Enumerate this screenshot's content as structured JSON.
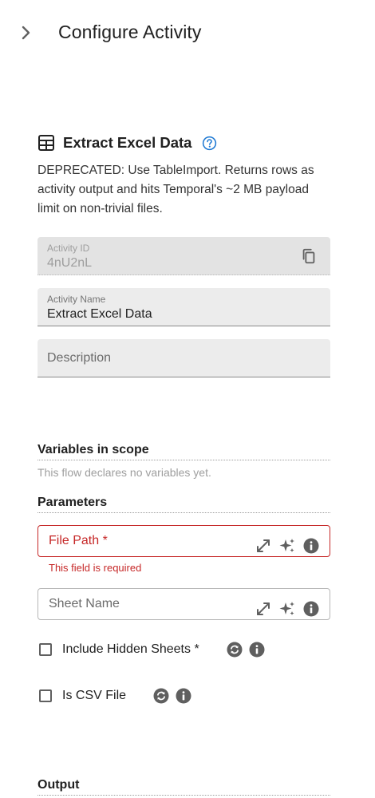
{
  "header": {
    "title": "Configure Activity"
  },
  "activity": {
    "title": "Extract Excel Data",
    "description": "DEPRECATED: Use TableImport. Returns rows as activity output and hits Temporal's ~2 MB payload limit on non-trivial files."
  },
  "fields": {
    "activity_id": {
      "label": "Activity ID",
      "value": "4nU2nL"
    },
    "activity_name": {
      "label": "Activity Name",
      "value": "Extract Excel Data"
    },
    "description": {
      "placeholder": "Description"
    }
  },
  "variables": {
    "heading": "Variables in scope",
    "note": "This flow declares no variables yet."
  },
  "parameters": {
    "heading": "Parameters",
    "file_path": {
      "label": "File Path *",
      "error": "This field is required"
    },
    "sheet_name": {
      "label": "Sheet Name"
    },
    "include_hidden_sheets": {
      "label": "Include Hidden Sheets *",
      "checked": false
    },
    "is_csv_file": {
      "label": "Is CSV File",
      "checked": false
    }
  },
  "output": {
    "heading": "Output"
  },
  "colors": {
    "error": "#c62828",
    "help_blue": "#1976d2",
    "icon_gray": "#5f5f5f"
  },
  "icons": [
    "chevron-right-icon",
    "table-icon",
    "help-icon",
    "copy-icon",
    "expand-icon",
    "sparkle-icon",
    "info-icon",
    "sync-icon"
  ]
}
